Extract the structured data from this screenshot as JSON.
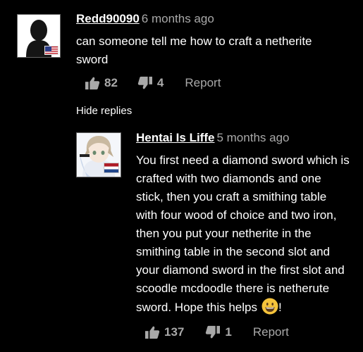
{
  "comments": [
    {
      "username": "Redd90090",
      "time": "6 months ago",
      "text": "can someone tell me how to craft a netherite sword",
      "likes": "82",
      "dislikes": "4",
      "report_label": "Report",
      "flag": "US"
    },
    {
      "username": "Hentai Is Liffe",
      "time": "5 months ago",
      "text": "You first need a diamond sword which is crafted with two diamonds and one stick, then you craft a smithing table with four wood of choice and two iron, then you put your netherite in the smithing table in the second slot and your diamond sword in the first slot and scoodle mcdoodle there is netherute sword. Hope this helps",
      "text_suffix": "!",
      "likes": "137",
      "dislikes": "1",
      "report_label": "Report",
      "flag": "NL"
    }
  ],
  "hide_replies_label": "Hide replies",
  "icons": {
    "like": "thumbs-up-icon",
    "dislike": "thumbs-down-icon",
    "emoji": "grinning-face-emoji"
  },
  "colors": {
    "background": "#000000",
    "text": "#ffffff",
    "muted": "#a9a9a9"
  }
}
